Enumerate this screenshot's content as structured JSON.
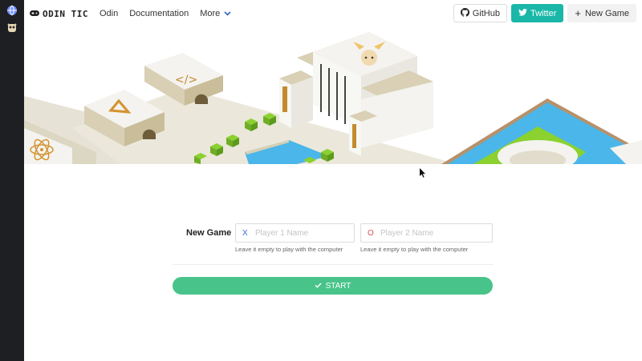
{
  "brand": {
    "name": "ODIN TIC"
  },
  "nav": {
    "links": [
      {
        "label": "Odin"
      },
      {
        "label": "Documentation"
      },
      {
        "label": "More"
      }
    ],
    "github_label": "GitHub",
    "twitter_label": "Twitter",
    "new_game_label": "New Game"
  },
  "form": {
    "title": "New Game",
    "player1": {
      "symbol": "X",
      "placeholder": "Player 1 Name",
      "value": "",
      "hint": "Leave it empty to play with the computer"
    },
    "player2": {
      "symbol": "O",
      "placeholder": "Player 2 Name",
      "value": "",
      "hint": "Leave it empty to play with the computer"
    },
    "start_label": "START"
  },
  "colors": {
    "accent_green": "#48c48a",
    "twitter": "#1ab7a8",
    "x_color": "#3b6fd6",
    "o_color": "#d9534f"
  }
}
